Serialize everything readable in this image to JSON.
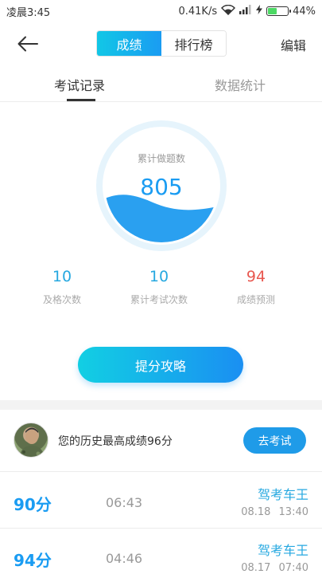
{
  "status_bar": {
    "time": "凌晨3:45",
    "network_speed": "0.41K/s",
    "battery_percent": "44%",
    "battery_level": 0.44
  },
  "header": {
    "tabs": [
      "成绩",
      "排行榜"
    ],
    "active_tab": 0,
    "edit_label": "编辑"
  },
  "subtabs": {
    "items": [
      "考试记录",
      "数据统计"
    ],
    "active": 0
  },
  "gauge": {
    "label": "累计做题数",
    "value": "805"
  },
  "stats": [
    {
      "value": "10",
      "label": "及格次数",
      "color": "#26a8e0"
    },
    {
      "value": "10",
      "label": "累计考试次数",
      "color": "#26a8e0"
    },
    {
      "value": "94",
      "label": "成绩预测",
      "color": "#e8574f"
    }
  ],
  "cta": {
    "label": "提分攻略"
  },
  "best": {
    "text": "您的历史最高成绩96分",
    "button_label": "去考试"
  },
  "records": [
    {
      "score": "90分",
      "time": "06:43",
      "source": "驾考车王",
      "date": "08.18 13:40"
    },
    {
      "score": "94分",
      "time": "04:46",
      "source": "驾考车王",
      "date": "08.17 07:40"
    }
  ],
  "colors": {
    "accent": "#1a9cf2",
    "accent_light": "#12c7e6",
    "prediction": "#e8574f"
  }
}
